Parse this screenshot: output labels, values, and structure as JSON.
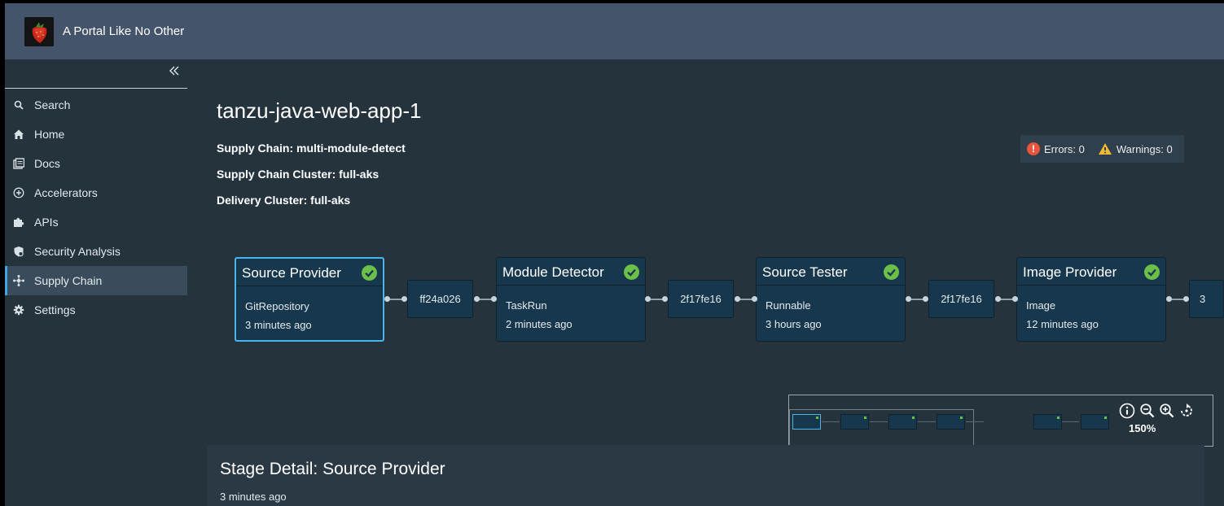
{
  "app": {
    "title": "A Portal Like No Other"
  },
  "sidebar": {
    "collapse_icon": "double-chevron-left-icon",
    "items": [
      {
        "label": "Search",
        "icon": "search-icon"
      },
      {
        "label": "Home",
        "icon": "home-icon"
      },
      {
        "label": "Docs",
        "icon": "docs-icon"
      },
      {
        "label": "Accelerators",
        "icon": "plus-circle-icon"
      },
      {
        "label": "APIs",
        "icon": "puzzle-icon"
      },
      {
        "label": "Security Analysis",
        "icon": "shield-icon"
      },
      {
        "label": "Supply Chain",
        "icon": "network-icon",
        "active": true
      },
      {
        "label": "Settings",
        "icon": "gear-icon"
      }
    ]
  },
  "workload": {
    "name": "tanzu-java-web-app-1",
    "supply_chain": "Supply Chain: multi-module-detect",
    "supply_chain_cluster": "Supply Chain Cluster: full-aks",
    "delivery_cluster": "Delivery Cluster: full-aks"
  },
  "status": {
    "errors": "Errors: 0",
    "warnings": "Warnings: 0"
  },
  "graph": {
    "nodes": [
      {
        "title": "Source Provider",
        "kind": "GitRepository",
        "ago": "3 minutes ago",
        "status": "success",
        "selected": true
      },
      {
        "title": "Module Detector",
        "kind": "TaskRun",
        "ago": "2 minutes ago",
        "status": "success"
      },
      {
        "title": "Source Tester",
        "kind": "Runnable",
        "ago": "3 hours ago",
        "status": "success"
      },
      {
        "title": "Image Provider",
        "kind": "Image",
        "ago": "12 minutes ago",
        "status": "success"
      }
    ],
    "revisions": [
      "ff24a026",
      "2f17fe16",
      "2f17fe16",
      "3"
    ]
  },
  "minimap": {
    "zoom": "150%",
    "controls": [
      "info-icon",
      "zoom-out-icon",
      "zoom-in-icon",
      "reset-icon"
    ]
  },
  "stage_detail": {
    "title": "Stage Detail: Source Provider",
    "ago": "3 minutes ago"
  },
  "colors": {
    "header": "#44546a",
    "background": "#25333d",
    "node": "#17384c",
    "selected": "#4ab5ea",
    "success": "#6cc04a",
    "error": "#e8553f",
    "warning": "#f1b93a"
  }
}
